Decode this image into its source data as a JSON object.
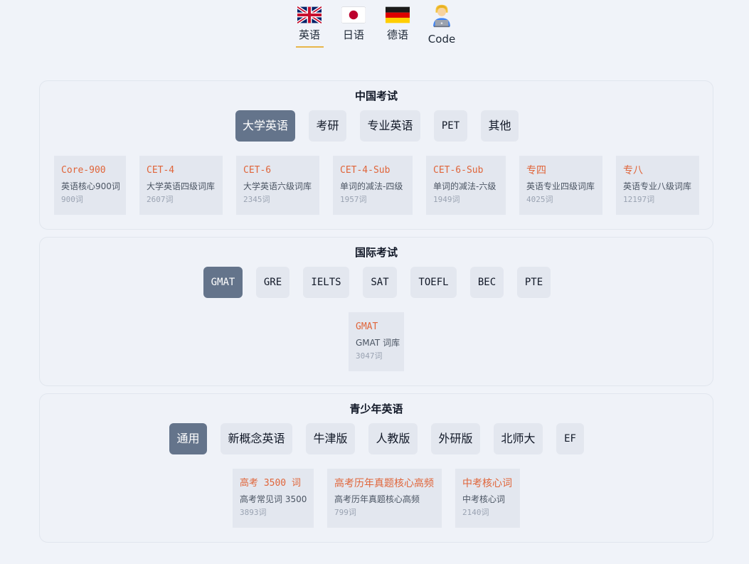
{
  "languages": [
    {
      "label": "英语",
      "icon": "uk-flag-icon",
      "active": true
    },
    {
      "label": "日语",
      "icon": "japan-flag-icon"
    },
    {
      "label": "德语",
      "icon": "germany-flag-icon"
    },
    {
      "label": "Code",
      "icon": "technologist-icon"
    }
  ],
  "colors": {
    "accent_underline": "#e8b64a",
    "active_pill": "#64748b",
    "card_title": "#e0653a"
  },
  "sections": [
    {
      "title": "中国考试",
      "tabs": [
        "大学英语",
        "考研",
        "专业英语",
        "PET",
        "其他"
      ],
      "active_tab": "大学英语",
      "cards": [
        {
          "name": "Core-900",
          "desc": "英语核心900词",
          "count": "900词"
        },
        {
          "name": "CET-4",
          "desc": "大学英语四级词库",
          "count": "2607词"
        },
        {
          "name": "CET-6",
          "desc": "大学英语六级词库",
          "count": "2345词"
        },
        {
          "name": "CET-4-Sub",
          "desc": "单词的减法-四级",
          "count": "1957词"
        },
        {
          "name": "CET-6-Sub",
          "desc": "单词的减法-六级",
          "count": "1949词"
        },
        {
          "name": "专四",
          "desc": "英语专业四级词库",
          "count": "4025词"
        },
        {
          "name": "专八",
          "desc": "英语专业八级词库",
          "count": "12197词"
        }
      ]
    },
    {
      "title": "国际考试",
      "tabs": [
        "GMAT",
        "GRE",
        "IELTS",
        "SAT",
        "TOEFL",
        "BEC",
        "PTE"
      ],
      "active_tab": "GMAT",
      "cards": [
        {
          "name": "GMAT",
          "desc": "GMAT 词库",
          "count": "3047词"
        }
      ]
    },
    {
      "title": "青少年英语",
      "tabs": [
        "通用",
        "新概念英语",
        "牛津版",
        "人教版",
        "外研版",
        "北师大",
        "EF"
      ],
      "active_tab": "通用",
      "cards": [
        {
          "name": "高考 3500 词",
          "desc": "高考常见词 3500",
          "count": "3893词"
        },
        {
          "name": "高考历年真题核心高频",
          "desc": "高考历年真题核心高频",
          "count": "799词"
        },
        {
          "name": "中考核心词",
          "desc": "中考核心词",
          "count": "2140词"
        }
      ]
    }
  ]
}
